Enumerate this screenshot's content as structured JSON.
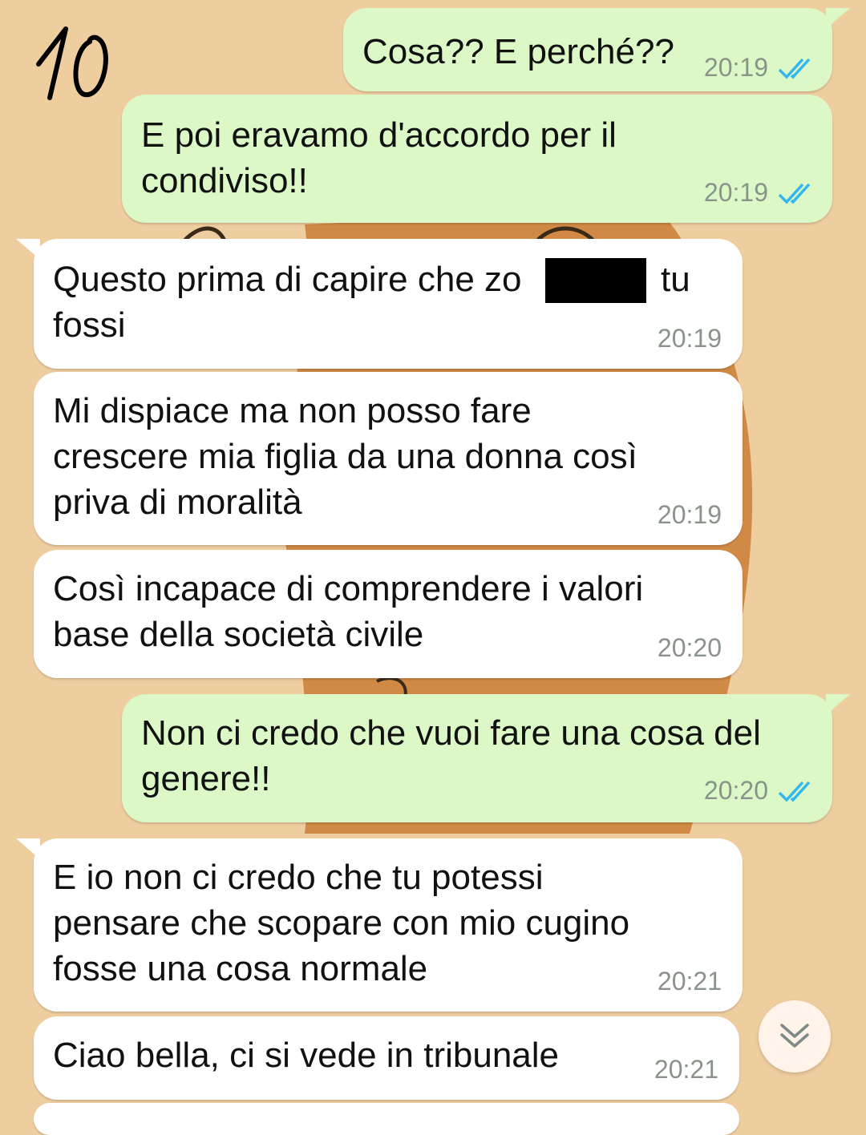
{
  "colors": {
    "wallpaper": "#eecd9f",
    "outgoing_bubble": "#dcf8c6",
    "incoming_bubble": "#ffffff",
    "read_ticks": "#34b7f1",
    "timestamp": "#8a9389",
    "annotation_ink": "#000000"
  },
  "annotation": {
    "label": "10"
  },
  "messages": [
    {
      "direction": "outgoing",
      "lines": [
        "Cosa?? E perché??"
      ],
      "time": "20:19",
      "status": "read"
    },
    {
      "direction": "outgoing",
      "lines": [
        "E poi eravamo d'accordo per il",
        "condiviso!!"
      ],
      "time": "20:19",
      "status": "read"
    },
    {
      "direction": "incoming",
      "lines": [
        "Questo prima di capire che zo",
        "fossi"
      ],
      "line1_tail": "tu",
      "time": "20:19",
      "redacted": true
    },
    {
      "direction": "incoming",
      "lines": [
        "Mi dispiace ma non posso fare",
        "crescere mia figlia da una donna così",
        "priva di moralità"
      ],
      "time": "20:19"
    },
    {
      "direction": "incoming",
      "lines": [
        "Così incapace di comprendere i valori",
        "base della società civile"
      ],
      "time": "20:20"
    },
    {
      "direction": "outgoing",
      "lines": [
        "Non ci credo che vuoi fare una cosa del",
        "genere!!"
      ],
      "time": "20:20",
      "status": "read"
    },
    {
      "direction": "incoming",
      "lines": [
        "E io non ci credo che tu potessi",
        "pensare che scopare con mio cugino",
        "fosse una cosa normale"
      ],
      "time": "20:21"
    },
    {
      "direction": "incoming",
      "lines": [
        "Ciao bella, ci si vede in tribunale"
      ],
      "time": "20:21"
    }
  ],
  "scroll_button": {
    "icon": "double-chevron-down-icon"
  }
}
